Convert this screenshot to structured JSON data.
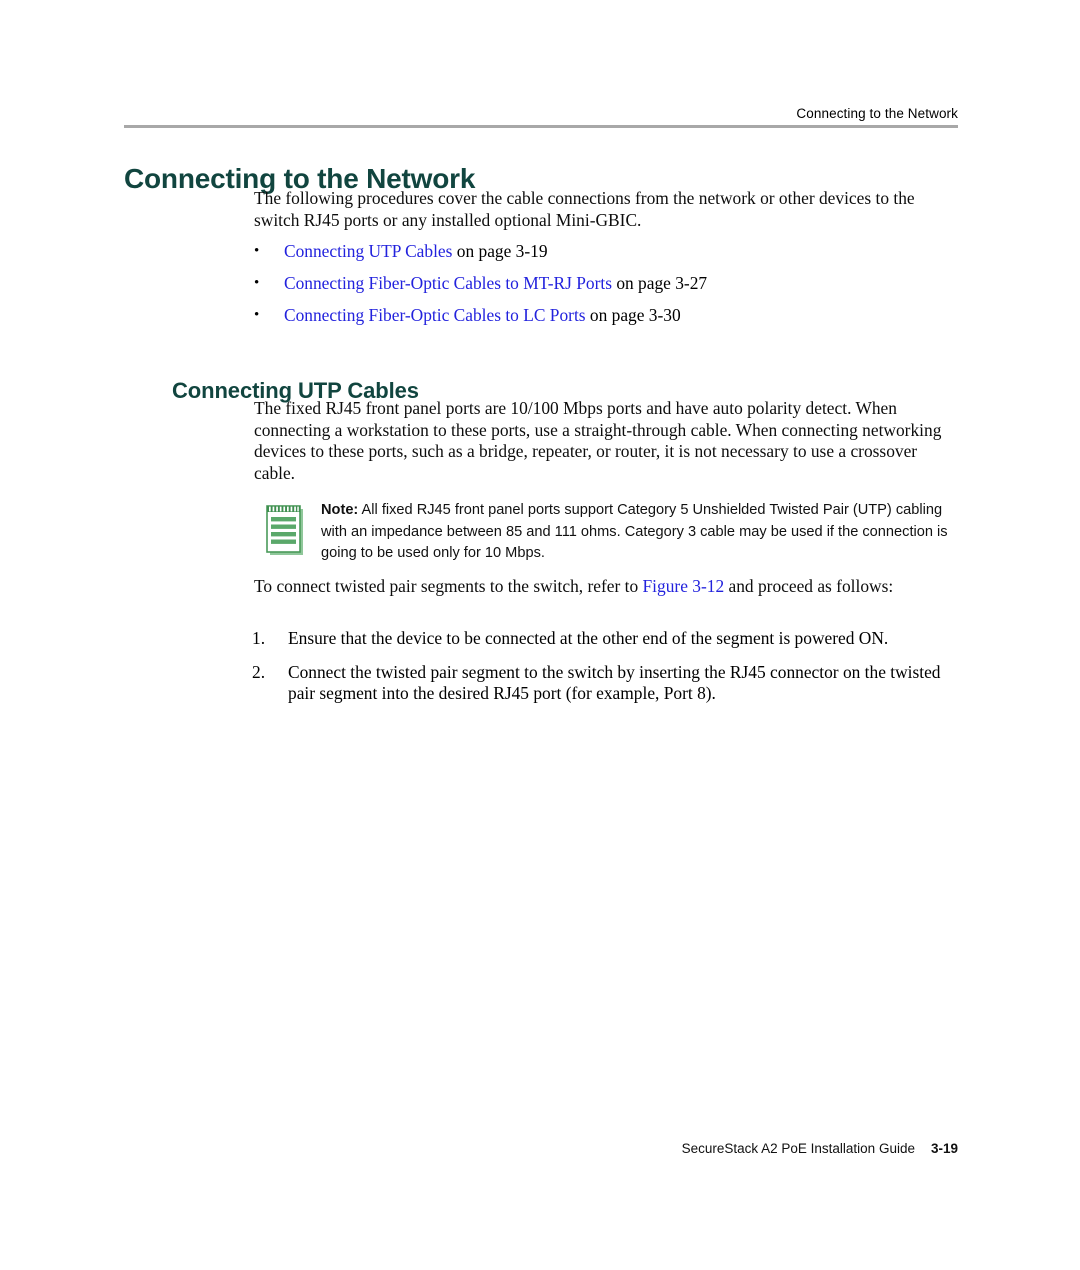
{
  "header": {
    "running_head": "Connecting to the Network"
  },
  "colors": {
    "heading_green": "#11453f",
    "link_blue": "#2222dd",
    "rule_gray": "#a8a8a8",
    "note_icon_green": "#4a9a5a"
  },
  "title": "Connecting to the Network",
  "intro_paragraph": "The following procedures cover the cable connections from the network or other devices to the switch RJ45 ports or any installed optional Mini-GBIC.",
  "bullets": [
    {
      "bullet": "•",
      "link": "Connecting UTP Cables",
      "suffix": " on page 3-19"
    },
    {
      "bullet": "•",
      "link": "Connecting Fiber-Optic Cables to MT-RJ Ports",
      "suffix": " on page 3-27"
    },
    {
      "bullet": "•",
      "link": "Connecting Fiber-Optic Cables to LC Ports",
      "suffix": " on page 3-30"
    }
  ],
  "section": {
    "heading": "Connecting UTP Cables",
    "paragraph": "The fixed RJ45 front panel ports are 10/100 Mbps ports and have auto polarity detect. When connecting a workstation to these ports, use a straight-through cable. When connecting networking devices to these ports, such as a bridge, repeater, or router, it is not necessary to use a crossover cable."
  },
  "note": {
    "icon_name": "note-pad-icon",
    "label": "Note:",
    "text": " All fixed RJ45 front panel ports support Category 5 Unshielded Twisted Pair (UTP) cabling with an impedance between 85 and 111 ohms. Category 3 cable may be used if the connection is going to be used only for 10 Mbps."
  },
  "figure_para": {
    "prefix": "To connect twisted pair segments to the switch, refer to ",
    "link": "Figure 3-12",
    "suffix": " and proceed as follows:"
  },
  "steps": [
    {
      "num": "1.",
      "text": "Ensure that the device to be connected at the other end of the segment is powered ON."
    },
    {
      "num": "2.",
      "text": "Connect the twisted pair segment to the switch by inserting the RJ45 connector on the twisted pair segment into the desired RJ45 port (for example, Port 8)."
    }
  ],
  "footer": {
    "guide": "SecureStack A2 PoE Installation Guide",
    "page": "3-19"
  }
}
